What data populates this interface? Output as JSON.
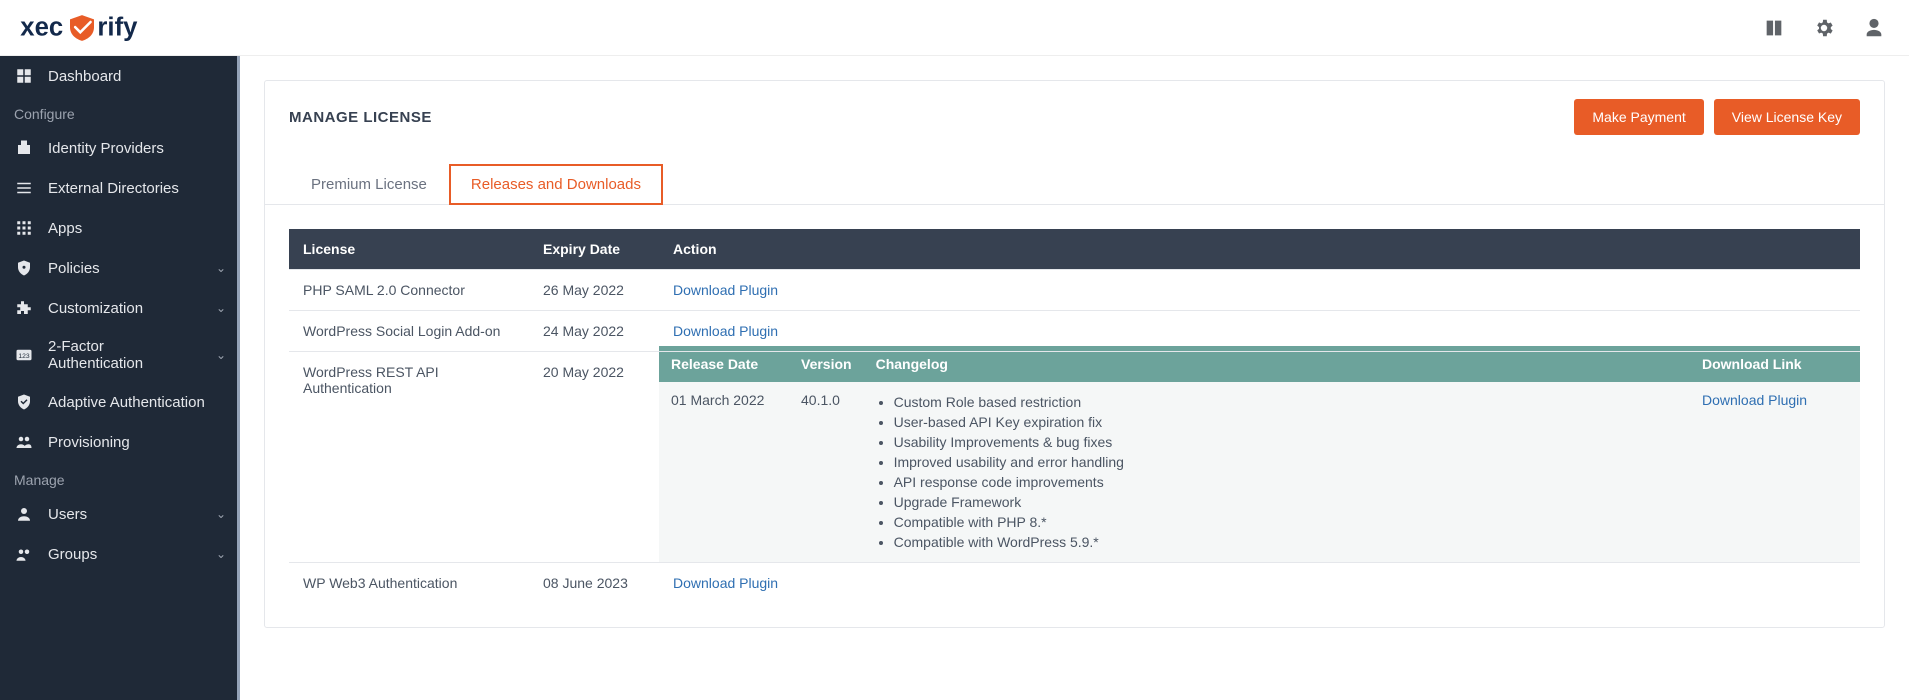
{
  "brand": "xecurify",
  "header": {
    "title": "MANAGE LICENSE",
    "make_payment": "Make Payment",
    "view_key": "View License Key"
  },
  "tabs": {
    "premium": "Premium License",
    "releases": "Releases and Downloads"
  },
  "sidebar": {
    "dashboard": "Dashboard",
    "section_configure": "Configure",
    "identity_providers": "Identity Providers",
    "external_directories": "External Directories",
    "apps": "Apps",
    "policies": "Policies",
    "customization": "Customization",
    "two_factor": "2-Factor Authentication",
    "adaptive": "Adaptive Authentication",
    "provisioning": "Provisioning",
    "section_manage": "Manage",
    "users": "Users",
    "groups": "Groups"
  },
  "table": {
    "headers": {
      "license": "License",
      "expiry": "Expiry Date",
      "action": "Action"
    },
    "rows": [
      {
        "license": "PHP SAML 2.0 Connector",
        "expiry": "26 May 2022",
        "action": "Download Plugin"
      },
      {
        "license": "WordPress Social Login Add-on",
        "expiry": "24 May 2022",
        "action": "Download Plugin"
      },
      {
        "license": "WordPress REST API Authentication",
        "expiry": "20 May 2022"
      },
      {
        "license": "WP Web3 Authentication",
        "expiry": "08 June 2023",
        "action": "Download Plugin"
      }
    ]
  },
  "releases": {
    "headers": {
      "date": "Release Date",
      "version": "Version",
      "changelog": "Changelog",
      "download": "Download Link"
    },
    "row": {
      "date": "01 March 2022",
      "version": "40.1.0",
      "download": "Download Plugin",
      "changelog": [
        "Custom Role based restriction",
        "User-based API Key expiration fix",
        "Usability Improvements & bug fixes",
        "Improved usability and error handling",
        "API response code improvements",
        "Upgrade Framework",
        "Compatible with PHP 8.*",
        "Compatible with WordPress 5.9.*"
      ]
    }
  }
}
